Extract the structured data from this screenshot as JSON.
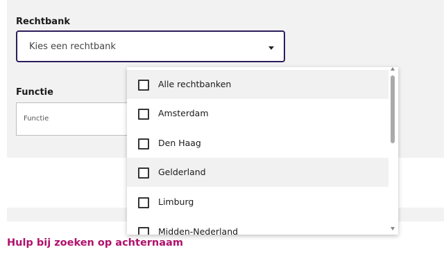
{
  "form": {
    "rechtbank_label": "Rechtbank",
    "rechtbank_placeholder": "Kies een rechtbank",
    "functie_label": "Functie",
    "functie_placeholder": "Functie"
  },
  "dropdown": {
    "options": [
      {
        "label": "Alle rechtbanken",
        "checked": false,
        "highlighted": true
      },
      {
        "label": "Amsterdam",
        "checked": false,
        "highlighted": false
      },
      {
        "label": "Den Haag",
        "checked": false,
        "highlighted": false
      },
      {
        "label": "Gelderland",
        "checked": false,
        "highlighted": true
      },
      {
        "label": "Limburg",
        "checked": false,
        "highlighted": false
      },
      {
        "label": "Midden-Nederland",
        "checked": false,
        "highlighted": false
      }
    ]
  },
  "help": {
    "link_text": "Hulp bij zoeken op achternaam"
  },
  "colors": {
    "panel_bg": "#f2f2f2",
    "select_border": "#2b1d5a",
    "help_link": "#b0116c"
  }
}
